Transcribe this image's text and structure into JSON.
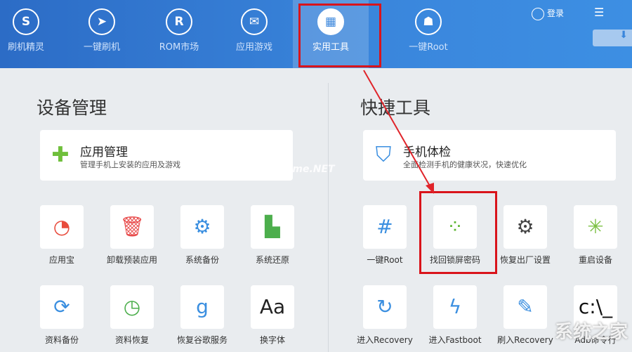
{
  "header": {
    "tabs": [
      {
        "label": "刷机精灵",
        "icon": "shield-s-icon",
        "glyph": "S"
      },
      {
        "label": "一键刷机",
        "icon": "cursor-icon",
        "glyph": "➤"
      },
      {
        "label": "ROM市场",
        "icon": "rom-r-icon",
        "glyph": "R"
      },
      {
        "label": "应用游戏",
        "icon": "bag-icon",
        "glyph": "✉"
      },
      {
        "label": "实用工具",
        "icon": "grid-icon",
        "glyph": "▦",
        "active": true
      },
      {
        "label": "一键Root",
        "icon": "android-icon",
        "glyph": "☗"
      }
    ],
    "login": "登录",
    "menu_glyph": "☰",
    "download_glyph": "⬇"
  },
  "left": {
    "title": "设备管理",
    "card": {
      "title": "应用管理",
      "subtitle": "管理手机上安装的应用及游戏",
      "glyph": "✚"
    },
    "tools": [
      {
        "label": "应用宝",
        "glyph": "◔",
        "color": "#e84c3d"
      },
      {
        "label": "卸载预装应用",
        "glyph": "🗑",
        "color": "#e84c4c"
      },
      {
        "label": "系统备份",
        "glyph": "⚙",
        "color": "#3b8fe0"
      },
      {
        "label": "系统还原",
        "glyph": "▙",
        "color": "#4cae4c"
      },
      {
        "label": "资料备份",
        "glyph": "⟳",
        "color": "#3b8fe0"
      },
      {
        "label": "资料恢复",
        "glyph": "◷",
        "color": "#4cae4c"
      },
      {
        "label": "恢复谷歌服务",
        "glyph": "g",
        "color": "#3b8fe0"
      },
      {
        "label": "换字体",
        "glyph": "Aa",
        "color": "#222"
      }
    ]
  },
  "right": {
    "title": "快捷工具",
    "card": {
      "title": "手机体检",
      "subtitle": "全面检测手机的健康状况，快速优化",
      "glyph": "⛉"
    },
    "tools": [
      {
        "label": "一键Root",
        "glyph": "#",
        "color": "#3b8fe0"
      },
      {
        "label": "找回锁屏密码",
        "glyph": "⁘",
        "color": "#5cb531"
      },
      {
        "label": "恢复出厂设置",
        "glyph": "⚙",
        "color": "#444"
      },
      {
        "label": "重启设备",
        "glyph": "✳",
        "color": "#7cc043"
      },
      {
        "label": "进入Recovery",
        "glyph": "↻",
        "color": "#3b8fe0"
      },
      {
        "label": "进入Fastboot",
        "glyph": "ϟ",
        "color": "#3b8fe0"
      },
      {
        "label": "刷入Recovery",
        "glyph": "✎",
        "color": "#3b8fe0"
      },
      {
        "label": "Adb命令行",
        "glyph": "c:\\_",
        "color": "#111"
      }
    ]
  },
  "watermarks": [
    "pHome.NET",
    "系统之家"
  ]
}
